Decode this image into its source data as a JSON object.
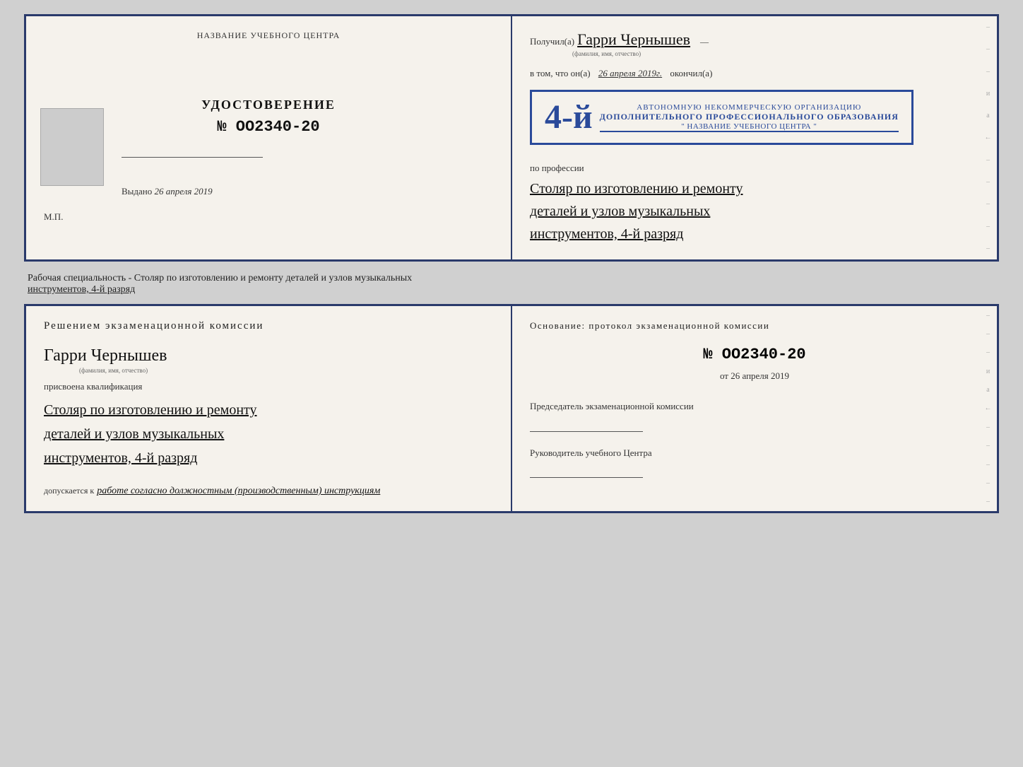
{
  "top_diploma": {
    "left": {
      "header": "НАЗВАНИЕ УЧЕБНОГО ЦЕНТРА",
      "photo_alt": "фото",
      "title": "УДОСТОВЕРЕНИЕ",
      "number_prefix": "№",
      "number": "OO2340-20",
      "issued_label": "Выдано",
      "issued_date": "26 апреля 2019",
      "mp_label": "М.П."
    },
    "right": {
      "recipient_prefix": "Получил(а)",
      "recipient_name": "Гарри Чернышев",
      "fio_label": "(фамилия, имя, отчество)",
      "completed_prefix": "в том, что он(а)",
      "completed_date": "26 апреля 2019г.",
      "completed_suffix": "окончил(а)",
      "stamp_year": "4-й",
      "stamp_line1": "АВТОНОМНУЮ НЕКОММЕРЧЕСКУЮ ОРГАНИЗАЦИЮ",
      "stamp_line2": "ДОПОЛНИТЕЛЬНОГО ПРОФЕССИОНАЛЬНОГО ОБРАЗОВАНИЯ",
      "stamp_org": "\" НАЗВАНИЕ УЧЕБНОГО ЦЕНТРА \"",
      "profession_label": "по профессии",
      "profession_line1": "Столяр по изготовлению и ремонту",
      "profession_line2": "деталей и узлов музыкальных",
      "profession_line3": "инструментов, 4-й разряд"
    }
  },
  "description": {
    "text1": "Рабочая специальность - Столяр по изготовлению и ремонту деталей и узлов музыкальных",
    "text2": "инструментов, 4-й разряд"
  },
  "bottom_diploma": {
    "left": {
      "commission_title": "Решением  экзаменационной  комиссии",
      "person_name": "Гарри Чернышев",
      "fio_label": "(фамилия, имя, отчество)",
      "qualification_label": "присвоена квалификация",
      "qual_line1": "Столяр по изготовлению и ремонту",
      "qual_line2": "деталей и узлов музыкальных",
      "qual_line3": "инструментов, 4-й разряд",
      "allowed_label": "допускается к",
      "allowed_value": "работе согласно должностным (производственным) инструкциям"
    },
    "right": {
      "basis_title": "Основание:  протокол  экзаменационной  комиссии",
      "number_prefix": "№",
      "number": "OO2340-20",
      "date_prefix": "от",
      "date": "26 апреля 2019",
      "chairman_title": "Председатель экзаменационной комиссии",
      "director_title": "Руководитель учебного Центра"
    }
  },
  "right_edge_chars": [
    "–",
    "–",
    "–",
    "и",
    "а̧",
    "←",
    "–",
    "–",
    "–",
    "–",
    "–"
  ]
}
